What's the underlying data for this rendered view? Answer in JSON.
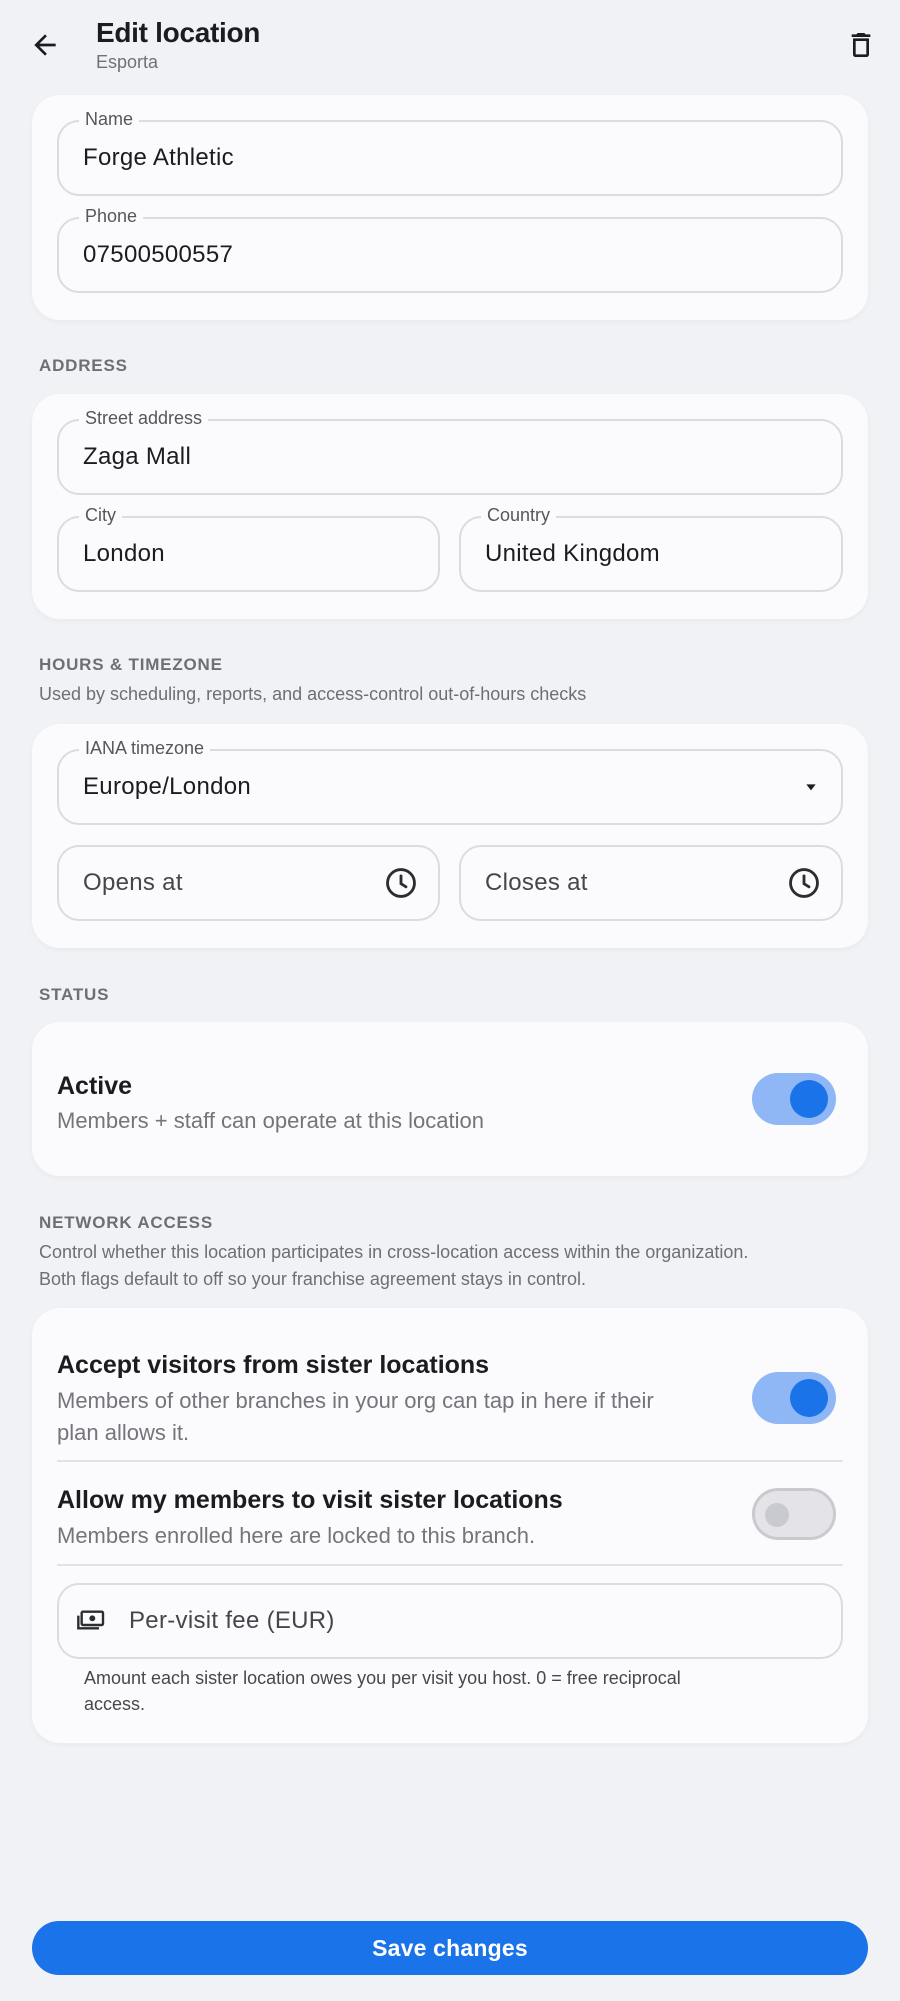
{
  "header": {
    "title": "Edit location",
    "subtitle": "Esporta"
  },
  "basic": {
    "name_label": "Name",
    "name_value": "Forge Athletic",
    "phone_label": "Phone",
    "phone_value": "07500500557"
  },
  "address": {
    "section_label": "ADDRESS",
    "street_label": "Street address",
    "street_value": "Zaga Mall",
    "city_label": "City",
    "city_value": "London",
    "country_label": "Country",
    "country_value": "United Kingdom"
  },
  "hours": {
    "section_label": "HOURS & TIMEZONE",
    "section_desc": "Used by scheduling, reports, and access-control out-of-hours checks",
    "timezone_label": "IANA timezone",
    "timezone_value": "Europe/London",
    "opens_placeholder": "Opens at",
    "closes_placeholder": "Closes at"
  },
  "status": {
    "section_label": "STATUS",
    "active_title": "Active",
    "active_desc": "Members + staff can operate at this location",
    "active_on": true
  },
  "network": {
    "section_label": "NETWORK ACCESS",
    "section_desc_line1": "Control whether this location participates in cross-location access within the organization.",
    "section_desc_line2": "Both flags default to off so your franchise agreement stays in control.",
    "accept_title": "Accept visitors from sister locations",
    "accept_desc_line1": "Members of other branches in your org can tap in here if their",
    "accept_desc_line2": "plan allows it.",
    "accept_on": true,
    "allow_title": "Allow my members to visit sister locations",
    "allow_desc": "Members enrolled here are locked to this branch.",
    "allow_on": false,
    "fee_placeholder": "Per-visit fee (EUR)",
    "fee_helper_line1": "Amount each sister location owes you per visit you host. 0 = free reciprocal",
    "fee_helper_line2": "access."
  },
  "actions": {
    "save_label": "Save changes"
  },
  "colors": {
    "accent": "#1a73e8",
    "accent_light": "#8fb7f5",
    "background": "#f1f2f5",
    "card": "#fbfbfe"
  },
  "icons": {
    "back": "arrow-back-icon",
    "delete": "trash-icon",
    "dropdown": "caret-down-icon",
    "clock": "clock-icon",
    "fee": "payments-icon"
  }
}
